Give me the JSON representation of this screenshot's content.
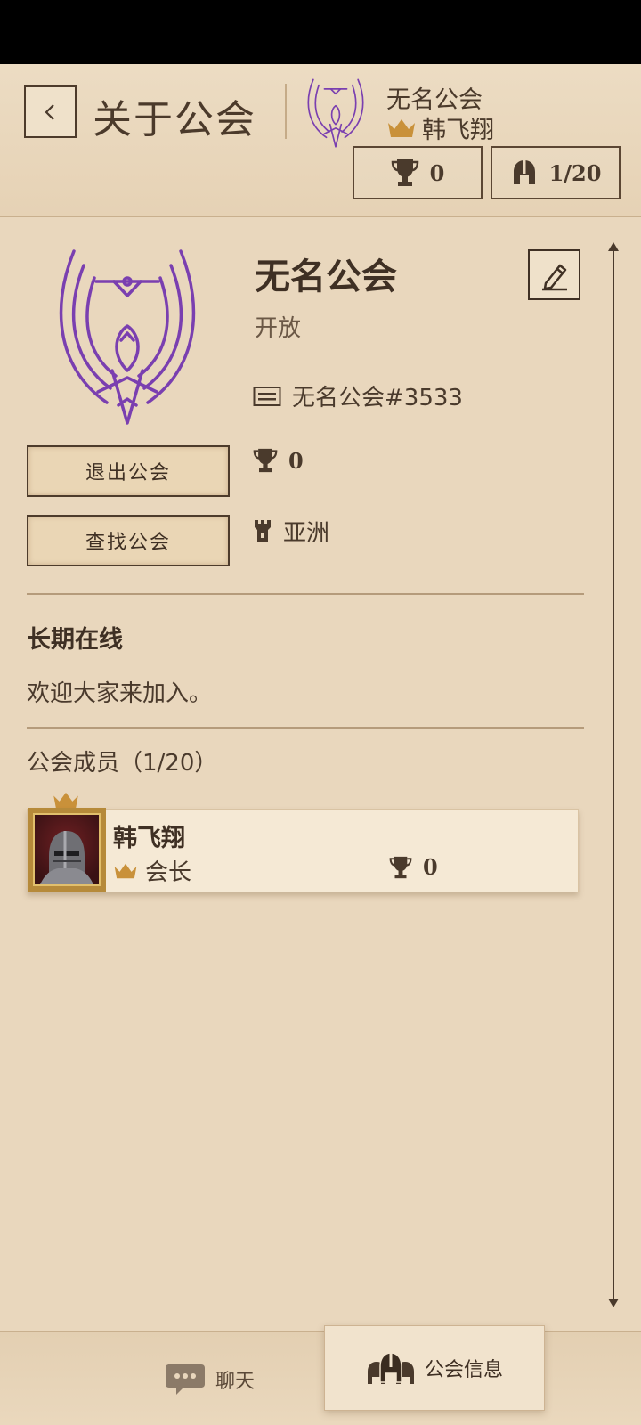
{
  "header": {
    "title": "关于公会",
    "guild_name": "无名公会",
    "leader_name": "韩飞翔",
    "trophies": "0",
    "members": "1/20"
  },
  "guild": {
    "name": "无名公会",
    "status": "开放",
    "id": "无名公会#3533",
    "trophies": "0",
    "region": "亚洲"
  },
  "actions": {
    "leave": "退出公会",
    "find": "查找公会"
  },
  "about": {
    "title": "长期在线",
    "description": "欢迎大家来加入。"
  },
  "members_section": {
    "title": "公会成员（1/20）",
    "members": [
      {
        "name": "韩飞翔",
        "role": "会长",
        "trophies": "0"
      }
    ]
  },
  "tabs": {
    "chat": "聊天",
    "guild_info": "公会信息"
  },
  "colors": {
    "parchment": "#e9d7bd",
    "ink": "#4a3a2c",
    "crown_gold": "#c9913a",
    "emblem_purple": "#7a3fb0"
  }
}
